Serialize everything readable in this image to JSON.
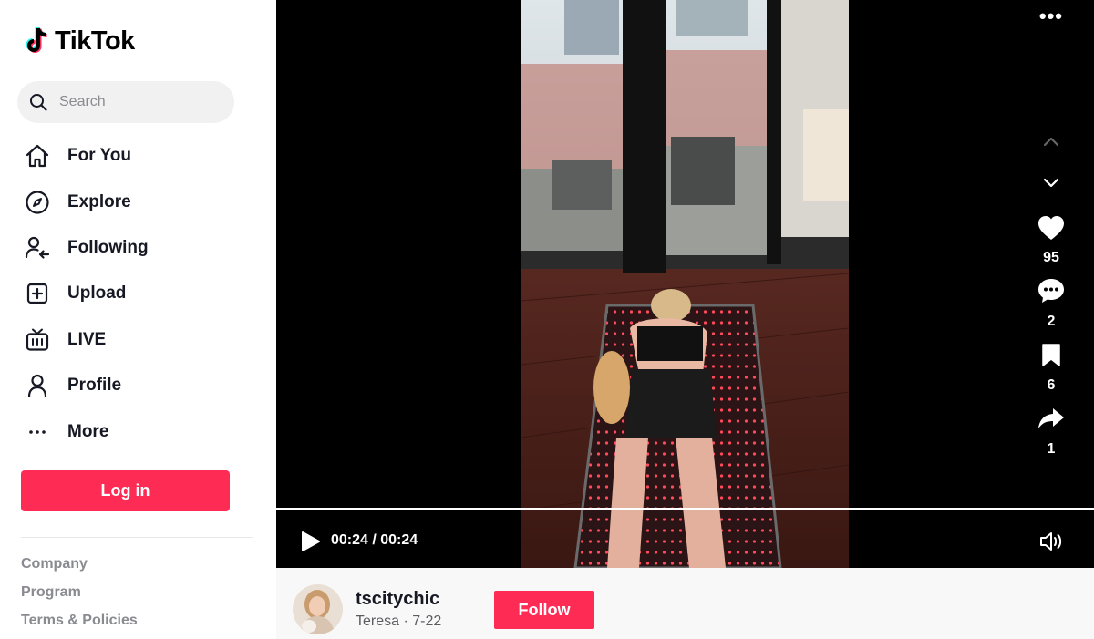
{
  "app": {
    "logo_text": "TikTok",
    "brand_color": "#fe2c55"
  },
  "search": {
    "placeholder": "Search"
  },
  "nav": {
    "items": [
      {
        "label": "For You",
        "icon": "home-icon"
      },
      {
        "label": "Explore",
        "icon": "compass-icon"
      },
      {
        "label": "Following",
        "icon": "following-icon"
      },
      {
        "label": "Upload",
        "icon": "upload-icon"
      },
      {
        "label": "LIVE",
        "icon": "live-tv-icon"
      },
      {
        "label": "Profile",
        "icon": "profile-icon"
      },
      {
        "label": "More",
        "icon": "more-dots-icon"
      }
    ]
  },
  "auth": {
    "login_label": "Log in"
  },
  "footer": {
    "links": [
      "Company",
      "Program",
      "Terms & Policies"
    ]
  },
  "video": {
    "time": "00:24 / 00:24",
    "progress": 1.0,
    "stats": {
      "likes": "95",
      "comments": "2",
      "saves": "6",
      "shares": "1"
    }
  },
  "author": {
    "username": "tscitychic",
    "display_name": "Teresa",
    "date": "7-22",
    "separator": "·",
    "follow_label": "Follow"
  }
}
